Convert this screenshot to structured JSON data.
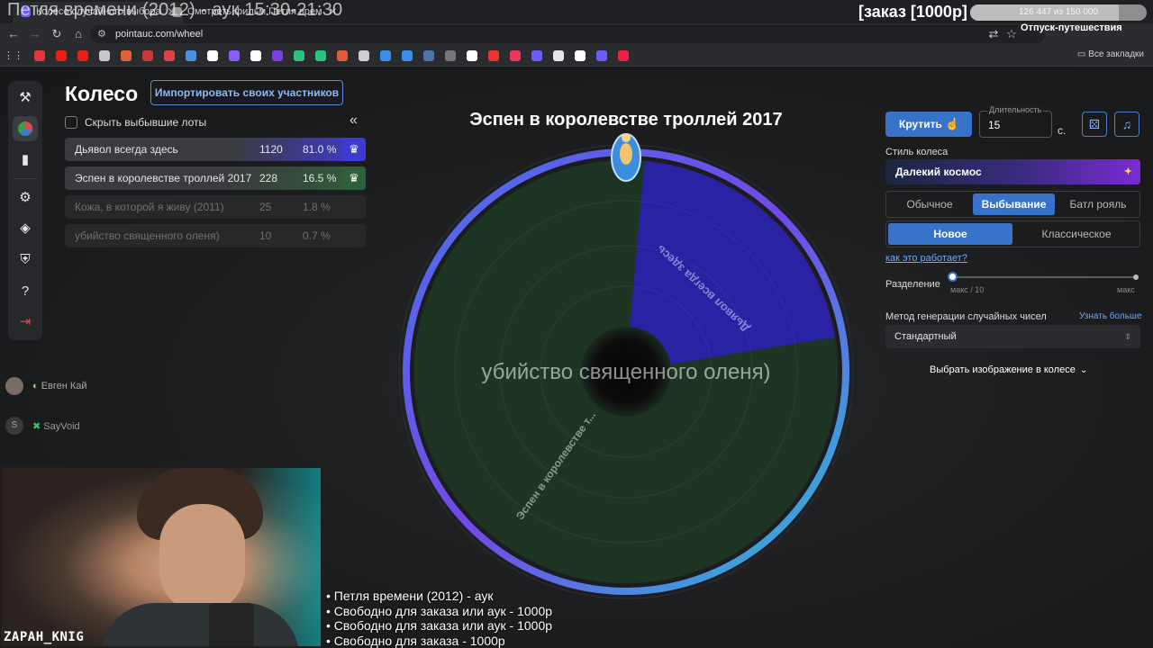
{
  "stream": {
    "title": "Петля времени (2012) - аук 15:30-21:30",
    "order_label": "[заказ [1000р]",
    "progress_text": "126 447  из 150 000",
    "progress_fraction": 0.843,
    "sub_label": "Отпуск-путешествия",
    "streamer": "ZAPAH_KNIG",
    "ticker": [
      "• Петля времени (2012) - аук",
      "• Свободно для заказа или аук - 1000р",
      "• Свободно для заказа или аук - 1000р",
      "• Свободно для заказа - 1000р"
    ]
  },
  "browser": {
    "tabs": [
      {
        "label": "Колесо случайного выбора"
      },
      {
        "label": "Смотреть фильм Петля врем"
      }
    ],
    "url": "pointauc.com/wheel",
    "all_bookmarks": "Все закладки",
    "bookmark_colors": [
      "#e03a3a",
      "#e62117",
      "#e62117",
      "#c8c8c8",
      "#e0623a",
      "#c83a3a",
      "#d44",
      "#4a90e2",
      "#ffffff",
      "#8a5cf6",
      "#ffffff",
      "#7b3fe4",
      "#2ec27e",
      "#2ec27e",
      "#e25b3a",
      "#cfcfcf",
      "#3b8eea",
      "#3b8eea",
      "#4a76a8",
      "#777",
      "#ffffff",
      "#e33",
      "#e5395d",
      "#6a5cff",
      "#e6e6e6",
      "#ffffff",
      "#6a5cff",
      "#e24"
    ]
  },
  "app": {
    "page_title": "Колесо",
    "import_button": "Импортировать своих участников",
    "hide_eliminated": "Скрыть выбывшие лоты",
    "collapse_icon": "«",
    "nav_icons": [
      "gavel-icon",
      "wheel-icon",
      "bar-chart-icon",
      "gear-icon",
      "layers-icon",
      "shield-icon",
      "help-icon",
      "logout-icon"
    ],
    "lots": [
      {
        "name": "Дьявол всегда здесь",
        "amount": "1120",
        "percent": "81.0 %",
        "color": "#3f3ad0",
        "eliminated": false
      },
      {
        "name": "Эспен в королевстве троллей 2017",
        "amount": "228",
        "percent": "16.5 %",
        "color": "#2f5e3a",
        "eliminated": false
      },
      {
        "name": "Кожа, в которой я живу (2011)",
        "amount": "25",
        "percent": "1.8 %",
        "eliminated": true
      },
      {
        "name": "убийство священного оленя)",
        "amount": "10",
        "percent": "0.7 %",
        "eliminated": true
      }
    ],
    "chat": [
      {
        "name": "Евген Кай",
        "color": "#a8a8a8"
      },
      {
        "name": "SayVoid",
        "color": "#9a9a9a"
      }
    ]
  },
  "wheel": {
    "current_title": "Эспен в королевстве троллей 2017",
    "center_text": "убийство священного оленя)",
    "label_devil": "Дьявол всегда здесь",
    "label_espen": "Эспен в королевстве т...",
    "devil_fraction": 0.21,
    "devil_color": "#2b1fb8",
    "espen_color": "#1e3524"
  },
  "controls": {
    "spin_button": "Крутить",
    "duration_legend": "Длительность",
    "duration_value": "15",
    "duration_unit": "с.",
    "dice_icon": "dice-icon",
    "music_icon": "music-icon",
    "style_label": "Стиль колеса",
    "style_value": "Далекий космос",
    "mode_tabs": [
      "Обычное",
      "Выбывание",
      "Батл рояль"
    ],
    "mode_active": "Выбывание",
    "sub_tabs": [
      "Новое",
      "Классическое"
    ],
    "sub_active": "Новое",
    "how_link": "как это работает?",
    "split_label": "Разделение",
    "split_min": "макс / 10",
    "split_max": "макс",
    "split_level": 0.0,
    "rng_label": "Метод генерации случайных чисел",
    "rng_more": "Узнать больше",
    "rng_value": "Стандартный",
    "image_pick": "Выбрать изображение в колесе"
  }
}
